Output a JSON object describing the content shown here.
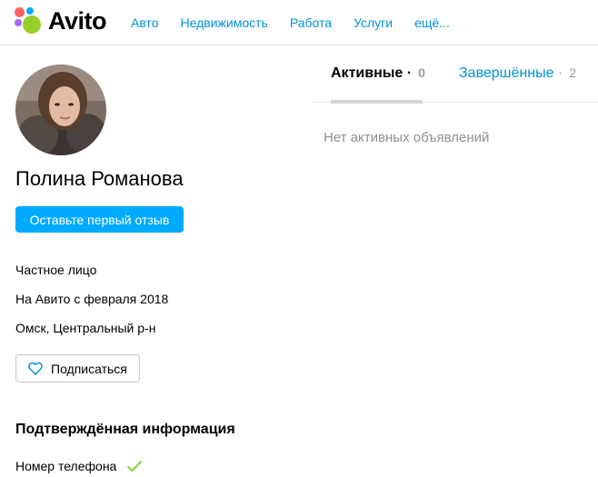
{
  "header": {
    "logo_text": "Avito",
    "nav": [
      "Авто",
      "Недвижимость",
      "Работа",
      "Услуги",
      "ещё..."
    ]
  },
  "profile": {
    "name": "Полина Романова",
    "review_button": "Оставьте первый отзыв",
    "type": "Частное лицо",
    "since": "На Авито с февраля 2018",
    "location": "Омск, Центральный р-н",
    "subscribe_button": "Подписаться",
    "verified_title": "Подтверждённая информация",
    "verified_items": [
      "Номер телефона"
    ]
  },
  "tabs": [
    {
      "label": "Активные",
      "count": "0"
    },
    {
      "label": "Завершённые",
      "count": "2"
    }
  ],
  "empty_state": "Нет активных объявлений",
  "colors": {
    "accent": "#00aaff",
    "link": "#0091d9",
    "check": "#8ccc3b",
    "logo_dots": [
      "#97cf26",
      "#a169f7",
      "#ff6163",
      "#00aaff"
    ]
  },
  "icons": {
    "subscribe": "heart-outline-icon",
    "verified": "checkmark-icon"
  }
}
